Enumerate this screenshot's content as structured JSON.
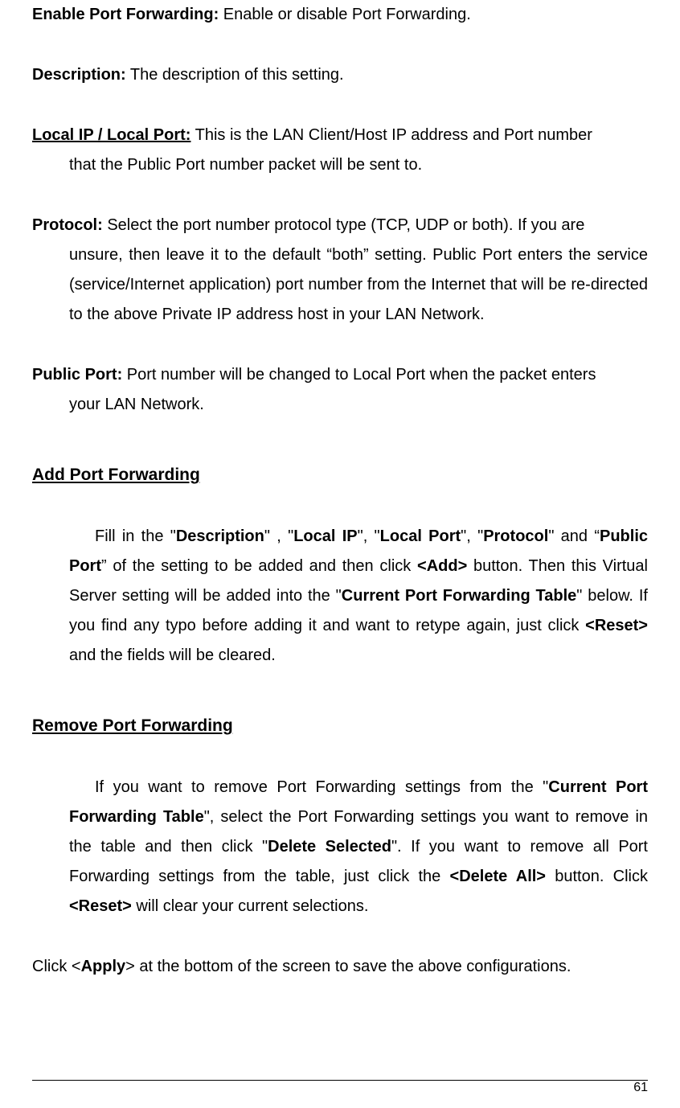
{
  "defs": {
    "enable": {
      "label": "Enable Port Forwarding:",
      "text": " Enable or disable Port Forwarding."
    },
    "description": {
      "label": "Description:",
      "text": " The description of this setting."
    },
    "localip": {
      "label": "Local IP / Local Port:",
      "text_inline": " This is the LAN Client/Host IP address and Port number",
      "text_rest": "that the Public Port number packet will be sent to."
    },
    "protocol": {
      "label": "Protocol:",
      "text_inline": " Select the port number protocol type (TCP, UDP or both). If you are",
      "text_rest": "unsure, then leave it to the default “both” setting. Public Port enters the service (service/Internet application) port number from the Internet that will be re-directed to the above Private IP address host in your LAN Network."
    },
    "publicport": {
      "label": "Public Port:",
      "text_inline": " Port number will be changed to Local Port when the packet enters",
      "text_rest": "your LAN Network."
    }
  },
  "add": {
    "heading": "Add Port Forwarding",
    "t1": "Fill in the \"",
    "b1": "Description",
    "t2": "\" , \"",
    "b2": "Local IP",
    "t3": "\", \"",
    "b3": "Local Port",
    "t4": "\", \"",
    "b4": "Protocol",
    "t5": "\" and “",
    "b5": "Public Port",
    "t6": "” of the setting to be added and then click ",
    "b6": "<Add>",
    "t7": " button. Then this Virtual Server setting will be added into the \"",
    "b7": "Current Port Forwarding Table",
    "t8": "\" below. If you find any typo before adding it and want to retype again, just click ",
    "b8": "<Reset>",
    "t9": " and the fields will be cleared."
  },
  "remove": {
    "heading": "Remove Port Forwarding",
    "t1": "If you want to remove Port Forwarding settings from the \"",
    "b1": "Current Port Forwarding Table",
    "t2": "\", select the Port Forwarding settings you want to remove in the table and then click \"",
    "b2": "Delete Selected",
    "t3": "\". If you want to remove all Port Forwarding settings from the table, just click the ",
    "b3": "<Delete All>",
    "t4": " button. Click ",
    "b4": "<Reset>",
    "t5": " will clear your current selections."
  },
  "final": {
    "t1": "Click <",
    "b1": "Apply",
    "t2": "> at the bottom of the screen to save the above configurations."
  },
  "page_num": "61"
}
